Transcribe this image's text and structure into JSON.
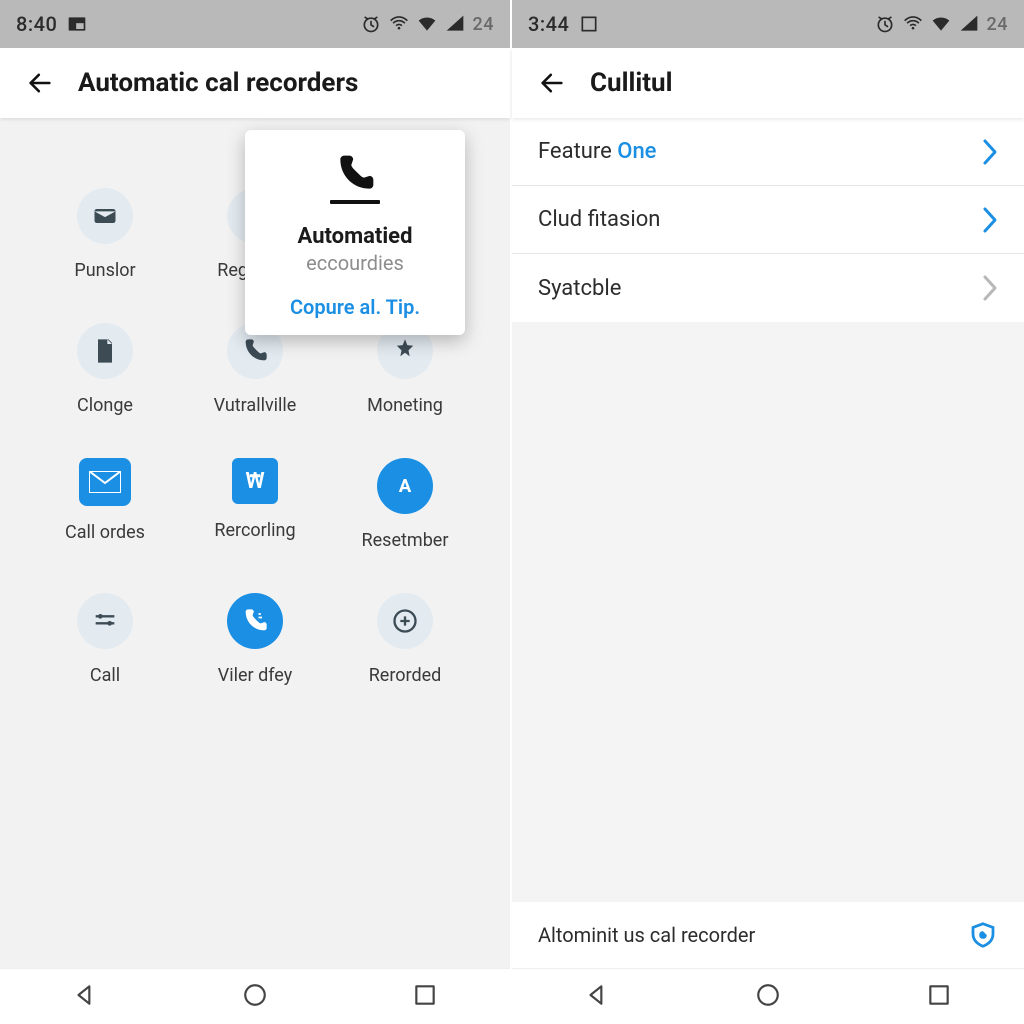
{
  "left": {
    "status": {
      "time": "8:40",
      "pct": "24"
    },
    "title": "Automatic cal recorders",
    "popup": {
      "line1": "Automatied",
      "line2": "eccourdies",
      "link": "Copure al. Tip."
    },
    "tiles": [
      {
        "label": "Punslor"
      },
      {
        "label": "Regraties"
      },
      {
        "label": ""
      },
      {
        "label": "Clonge"
      },
      {
        "label": "Vutrallville"
      },
      {
        "label": "Moneting"
      },
      {
        "label": "Call ordes"
      },
      {
        "label": "Rercorling"
      },
      {
        "label": "Resetmber"
      },
      {
        "label": "Call"
      },
      {
        "label": "Viler dfey"
      },
      {
        "label": "Rerorded"
      }
    ]
  },
  "right": {
    "status": {
      "time": "3:44",
      "pct": "24"
    },
    "title": "Cullitul",
    "rows": [
      {
        "text": "Feature ",
        "accent": "One"
      },
      {
        "text": "Clud fitasion",
        "accent": ""
      },
      {
        "text": "Syatcble",
        "accent": ""
      }
    ],
    "bottom": "Altominit us cal recorder"
  }
}
